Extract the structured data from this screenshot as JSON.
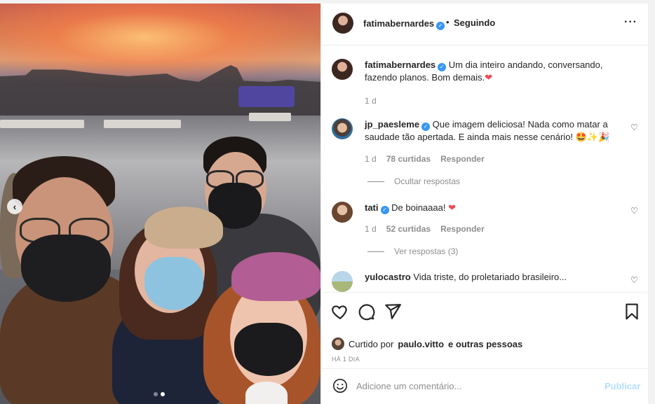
{
  "header": {
    "username": "fatimabernardes",
    "separator": "•",
    "follow_status": "Seguindo",
    "more_icon": "more-horizontal-icon"
  },
  "caption": {
    "username": "fatimabernardes",
    "text": "Um dia inteiro andando, conversando, fazendo planos. Bom demais.",
    "emoji": "❤",
    "time": "1 d"
  },
  "comments": [
    {
      "username": "jp_paesleme",
      "verified": true,
      "text": "Que imagem deliciosa! Nada como matar a saudade tão apertada. E ainda mais nesse cenário!",
      "emoji": "🤩✨🎉",
      "time": "1 d",
      "likes": "78 curtidas",
      "reply": "Responder",
      "replies_toggle": "Ocultar respostas"
    },
    {
      "username": "tati",
      "verified": true,
      "text": "De boinaaaa!",
      "emoji": "❤",
      "time": "1 d",
      "likes": "52 curtidas",
      "reply": "Responder",
      "replies_toggle": "Ver respostas (3)"
    },
    {
      "username": "yulocastro",
      "verified": false,
      "text": "Vida triste, do proletariado brasileiro...",
      "emoji": ""
    }
  ],
  "actions": {
    "liked_prefix": "Curtido por",
    "liked_user": "paulo.vitto",
    "liked_suffix": "e outras pessoas",
    "post_time": "HÁ 1 DIA"
  },
  "comment_box": {
    "placeholder": "Adicione um comentário...",
    "publish": "Publicar"
  },
  "carousel": {
    "prev_icon": "chevron-left-icon",
    "total_slides": 2,
    "active_slide": 2
  },
  "colors": {
    "verified": "#3897f0",
    "heart": "#ed4956",
    "muted": "#8e8e8e",
    "publish_disabled": "#b2dffc"
  }
}
